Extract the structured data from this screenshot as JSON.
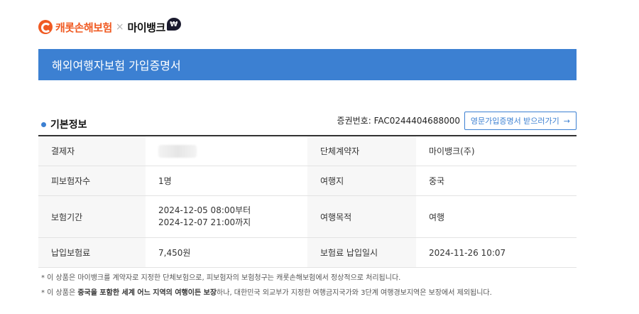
{
  "header": {
    "carrot_logo_text": "캐롯손해보험",
    "times": "×",
    "mybank_logo_text": "마이뱅크",
    "mybank_badge": "₩"
  },
  "banner": {
    "title": "해외여행자보험 가입증명서"
  },
  "section": {
    "title": "기본정보",
    "certificate_number": "증권번호: FAC0244404688000",
    "english_cert_button": "영문가입증명서 받으러가기",
    "english_cert_arrow": "→"
  },
  "table": {
    "rows": [
      {
        "label1": "결제자",
        "value1": "",
        "label2": "단체계약자",
        "value2": "마이뱅크(주)"
      },
      {
        "label1": "피보험자수",
        "value1": "1명",
        "label2": "여행지",
        "value2": "중국"
      },
      {
        "label1": "보험기간",
        "value1_line1": "2024-12-05 08:00부터",
        "value1_line2": "2024-12-07 21:00까지",
        "label2": "여행목적",
        "value2": "여행"
      },
      {
        "label1": "납입보험료",
        "value1": "7,450원",
        "label2": "보험료 납입일시",
        "value2": "2024-11-26 10:07"
      }
    ]
  },
  "notes": {
    "note1": "* 이 상품은 마이뱅크를 계약자로 지정한 단체보험으로, 피보험자의 보험청구는 캐롯손해보험에서 정상적으로 처리됩니다.",
    "note2_prefix": "* 이 상품은 ",
    "note2_bold": "중국을 포함한 세계 어느 지역의 여행이든 보장",
    "note2_suffix": "하나, 대한민국 외교부가 지정한 여행금지국가와 3단계 여행경보지역은 보장에서 제외됩니다."
  },
  "colors": {
    "brand_orange": "#f05a22",
    "banner_blue": "#3c80d2"
  }
}
